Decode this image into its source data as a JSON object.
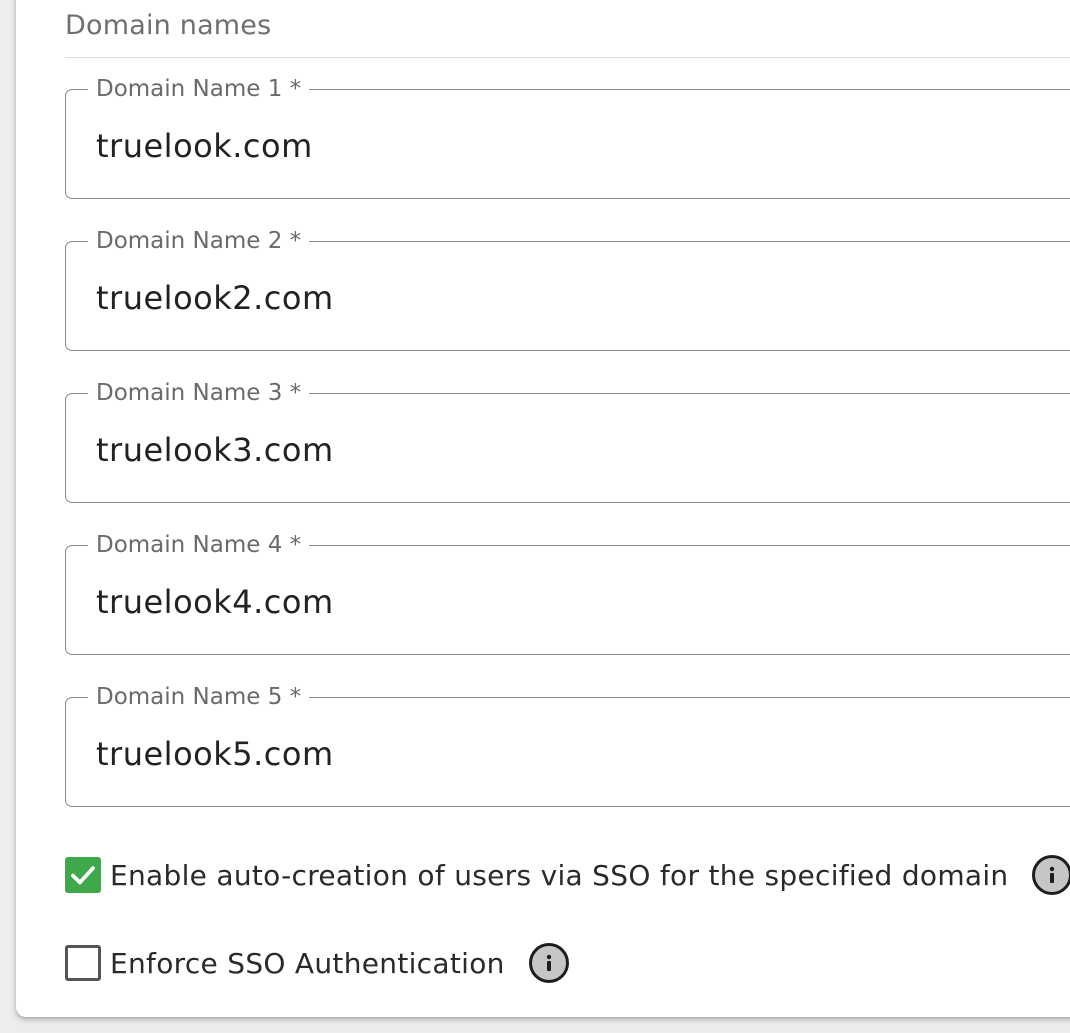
{
  "section": {
    "title": "Domain names"
  },
  "domains": [
    {
      "label": "Domain Name 1 *",
      "value": "truelook.com"
    },
    {
      "label": "Domain Name 2 *",
      "value": "truelook2.com"
    },
    {
      "label": "Domain Name 3 *",
      "value": "truelook3.com"
    },
    {
      "label": "Domain Name 4 *",
      "value": "truelook4.com"
    },
    {
      "label": "Domain Name 5 *",
      "value": "truelook5.com"
    }
  ],
  "options": {
    "auto_create": {
      "label": "Enable auto-creation of users via SSO for the specified domain",
      "checked": true,
      "info_icon": "info-icon"
    },
    "enforce_sso": {
      "label": "Enforce SSO Authentication",
      "checked": false,
      "info_icon": "info-icon"
    }
  },
  "colors": {
    "checkbox_checked": "#3fa84a",
    "field_border": "#8a8a8a",
    "label_text": "#6a6a6a"
  }
}
